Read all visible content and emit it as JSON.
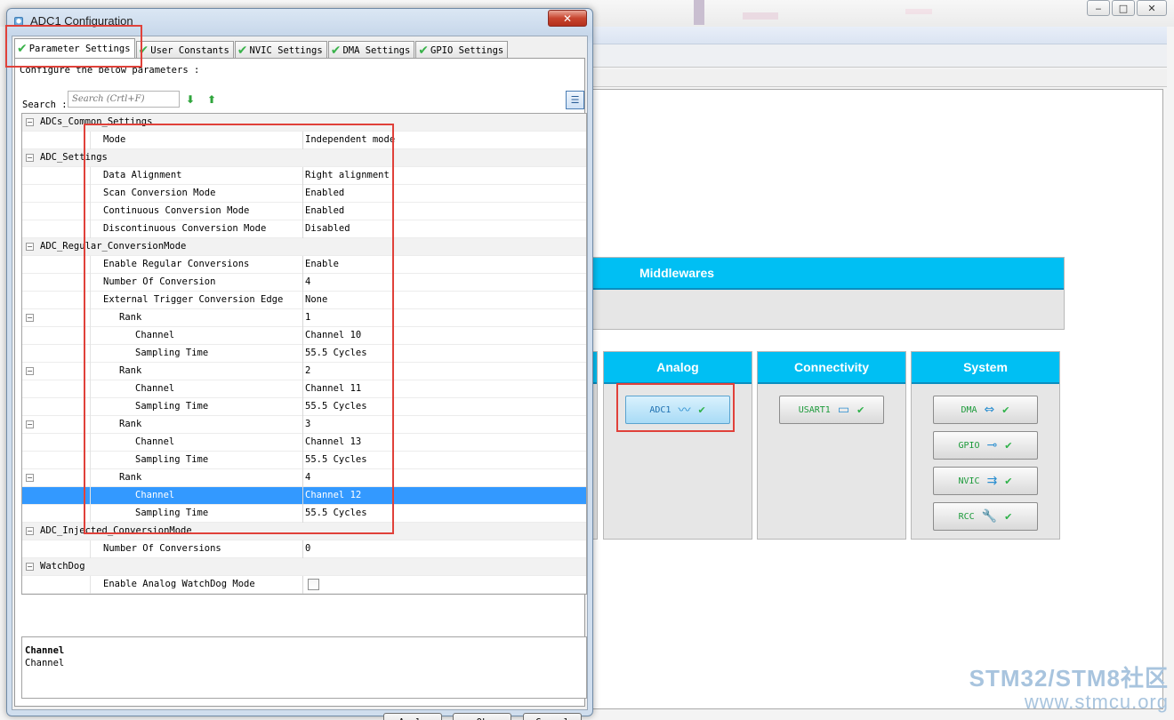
{
  "background": {
    "window_controls": [
      "‒",
      "□",
      "✕"
    ],
    "categories": [
      {
        "id": "middlewares",
        "title": "Middlewares"
      },
      {
        "id": "analog",
        "title": "Analog"
      },
      {
        "id": "connectivity",
        "title": "Connectivity"
      },
      {
        "id": "system",
        "title": "System"
      }
    ],
    "peripherals": [
      {
        "id": "adc1",
        "label": "ADC1",
        "icon": "waveform-icon",
        "glyph": "〰"
      },
      {
        "id": "usart1",
        "label": "USART1",
        "icon": "serial-port-icon",
        "glyph": "▭"
      },
      {
        "id": "dma",
        "label": "DMA",
        "icon": "dma-transfer-icon",
        "glyph": "⇔"
      },
      {
        "id": "gpio",
        "label": "GPIO",
        "icon": "gpio-pin-icon",
        "glyph": "⊸"
      },
      {
        "id": "nvic",
        "label": "NVIC",
        "icon": "interrupt-icon",
        "glyph": "⇉"
      },
      {
        "id": "rcc",
        "label": "RCC",
        "icon": "wrench-icon",
        "glyph": "🔧"
      }
    ],
    "watermark": {
      "line1": "STM32/STM8社区",
      "line2": "www.stmcu.org"
    }
  },
  "dialog": {
    "title": "ADC1 Configuration",
    "close_glyph": "✕",
    "tabs": [
      {
        "label": "Parameter Settings",
        "active": true
      },
      {
        "label": "User Constants",
        "active": false
      },
      {
        "label": "NVIC Settings",
        "active": false
      },
      {
        "label": "DMA Settings",
        "active": false
      },
      {
        "label": "GPIO Settings",
        "active": false
      }
    ],
    "configure_text": "Configure the below parameters :",
    "search": {
      "label": "Search :",
      "placeholder": "Search (Crtl+F)"
    },
    "tree": [
      {
        "type": "group",
        "name": "ADCs_Common_Settings"
      },
      {
        "type": "param",
        "level": 1,
        "name": "Mode",
        "value": "Independent mode"
      },
      {
        "type": "group",
        "name": "ADC_Settings"
      },
      {
        "type": "param",
        "level": 1,
        "name": "Data Alignment",
        "value": "Right alignment"
      },
      {
        "type": "param",
        "level": 1,
        "name": "Scan Conversion Mode",
        "value": "Enabled"
      },
      {
        "type": "param",
        "level": 1,
        "name": "Continuous Conversion Mode",
        "value": "Enabled"
      },
      {
        "type": "param",
        "level": 1,
        "name": "Discontinuous Conversion Mode",
        "value": "Disabled"
      },
      {
        "type": "group",
        "name": "ADC_Regular_ConversionMode"
      },
      {
        "type": "param",
        "level": 1,
        "name": "Enable Regular Conversions",
        "value": "Enable"
      },
      {
        "type": "param",
        "level": 1,
        "name": "Number Of Conversion",
        "value": "4"
      },
      {
        "type": "param",
        "level": 1,
        "name": "External Trigger Conversion Edge",
        "value": "None"
      },
      {
        "type": "rank",
        "level": 2,
        "name": "Rank",
        "value": "1"
      },
      {
        "type": "param",
        "level": 3,
        "name": "Channel",
        "value": "Channel 10"
      },
      {
        "type": "param",
        "level": 3,
        "name": "Sampling Time",
        "value": "55.5 Cycles"
      },
      {
        "type": "rank",
        "level": 2,
        "name": "Rank",
        "value": "2"
      },
      {
        "type": "param",
        "level": 3,
        "name": "Channel",
        "value": "Channel 11"
      },
      {
        "type": "param",
        "level": 3,
        "name": "Sampling Time",
        "value": "55.5 Cycles"
      },
      {
        "type": "rank",
        "level": 2,
        "name": "Rank",
        "value": "3"
      },
      {
        "type": "param",
        "level": 3,
        "name": "Channel",
        "value": "Channel 13"
      },
      {
        "type": "param",
        "level": 3,
        "name": "Sampling Time",
        "value": "55.5 Cycles"
      },
      {
        "type": "rank",
        "level": 2,
        "name": "Rank",
        "value": "4"
      },
      {
        "type": "param",
        "level": 3,
        "name": "Channel",
        "value": "Channel 12",
        "selected": true
      },
      {
        "type": "param",
        "level": 3,
        "name": "Sampling Time",
        "value": "55.5 Cycles"
      },
      {
        "type": "group",
        "name": "ADC_Injected_ConversionMode"
      },
      {
        "type": "param",
        "level": 1,
        "name": "Number Of Conversions",
        "value": "0"
      },
      {
        "type": "group",
        "name": "WatchDog"
      },
      {
        "type": "checkbox",
        "level": 1,
        "name": "Enable Analog WatchDog Mode",
        "checked": false
      }
    ],
    "description": {
      "title": "Channel",
      "text": "Channel"
    },
    "buttons": {
      "apply": "Apply",
      "ok": "Ok",
      "cancel": "Cancel"
    }
  }
}
